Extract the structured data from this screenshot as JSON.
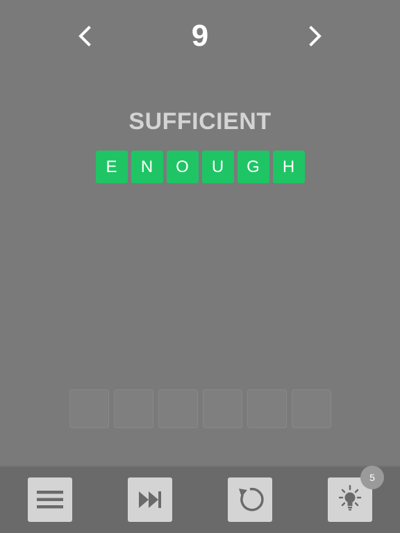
{
  "header": {
    "level": "9",
    "prev_icon": "chevron-left-icon",
    "next_icon": "chevron-right-icon"
  },
  "puzzle": {
    "clue": "SUFFICIENT",
    "answer_letters": [
      "E",
      "N",
      "O",
      "U",
      "G",
      "H"
    ],
    "empty_slots": 6
  },
  "toolbar": {
    "menu_icon": "menu-icon",
    "skip_icon": "fast-forward-icon",
    "reset_icon": "refresh-icon",
    "hint_icon": "lightbulb-icon",
    "hint_count": "5"
  },
  "colors": {
    "background": "#7a7a7a",
    "tile": "#1fc564",
    "toolbar": "#6a6a6a",
    "button": "#d4d4d4"
  }
}
